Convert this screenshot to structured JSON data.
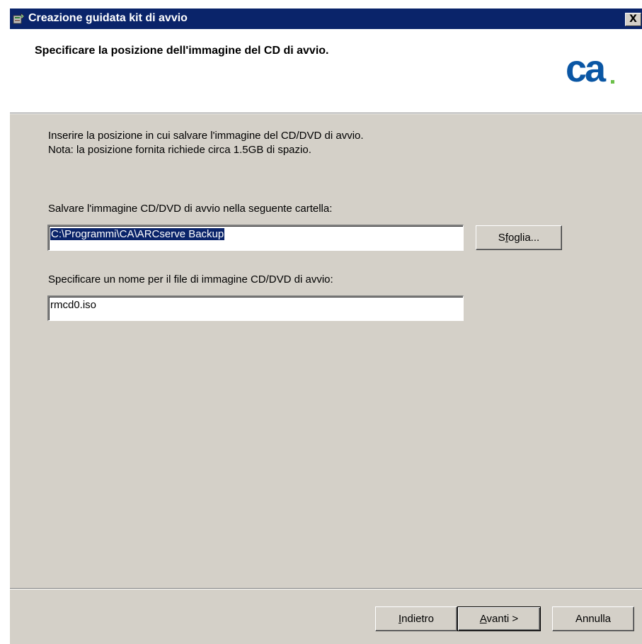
{
  "window": {
    "title": "Creazione guidata kit di avvio",
    "close_glyph": "X"
  },
  "header": {
    "title": "Specificare la posizione dell'immagine del CD di avvio.",
    "logo_text": "ca",
    "logo_color": "#0a56a4",
    "logo_dot_color": "#6cc04a"
  },
  "body": {
    "intro_line1": "Inserire la posizione in cui salvare l'immagine del CD/DVD di avvio.",
    "intro_line2": "Nota: la posizione fornita richiede circa 1.5GB di spazio.",
    "folder_label": "Salvare l'immagine CD/DVD di avvio nella seguente cartella:",
    "folder_value": "C:\\Programmi\\CA\\ARCserve Backup",
    "browse_prefix": "S",
    "browse_hotkey": "f",
    "browse_suffix": "oglia...",
    "filename_label": "Specificare un nome per il file di immagine CD/DVD di avvio:",
    "filename_value": "rmcd0.iso"
  },
  "footer": {
    "back_hotkey": "I",
    "back_rest": "ndietro",
    "next_hotkey": "A",
    "next_rest": "vanti >",
    "cancel_label": "Annulla"
  },
  "colors": {
    "titlebar": "#0a246a",
    "dialog_face": "#d4d0c8",
    "selection": "#0a246a"
  },
  "icons": {
    "title_icon": "wizard-kit-icon",
    "close_icon": "close-icon"
  }
}
